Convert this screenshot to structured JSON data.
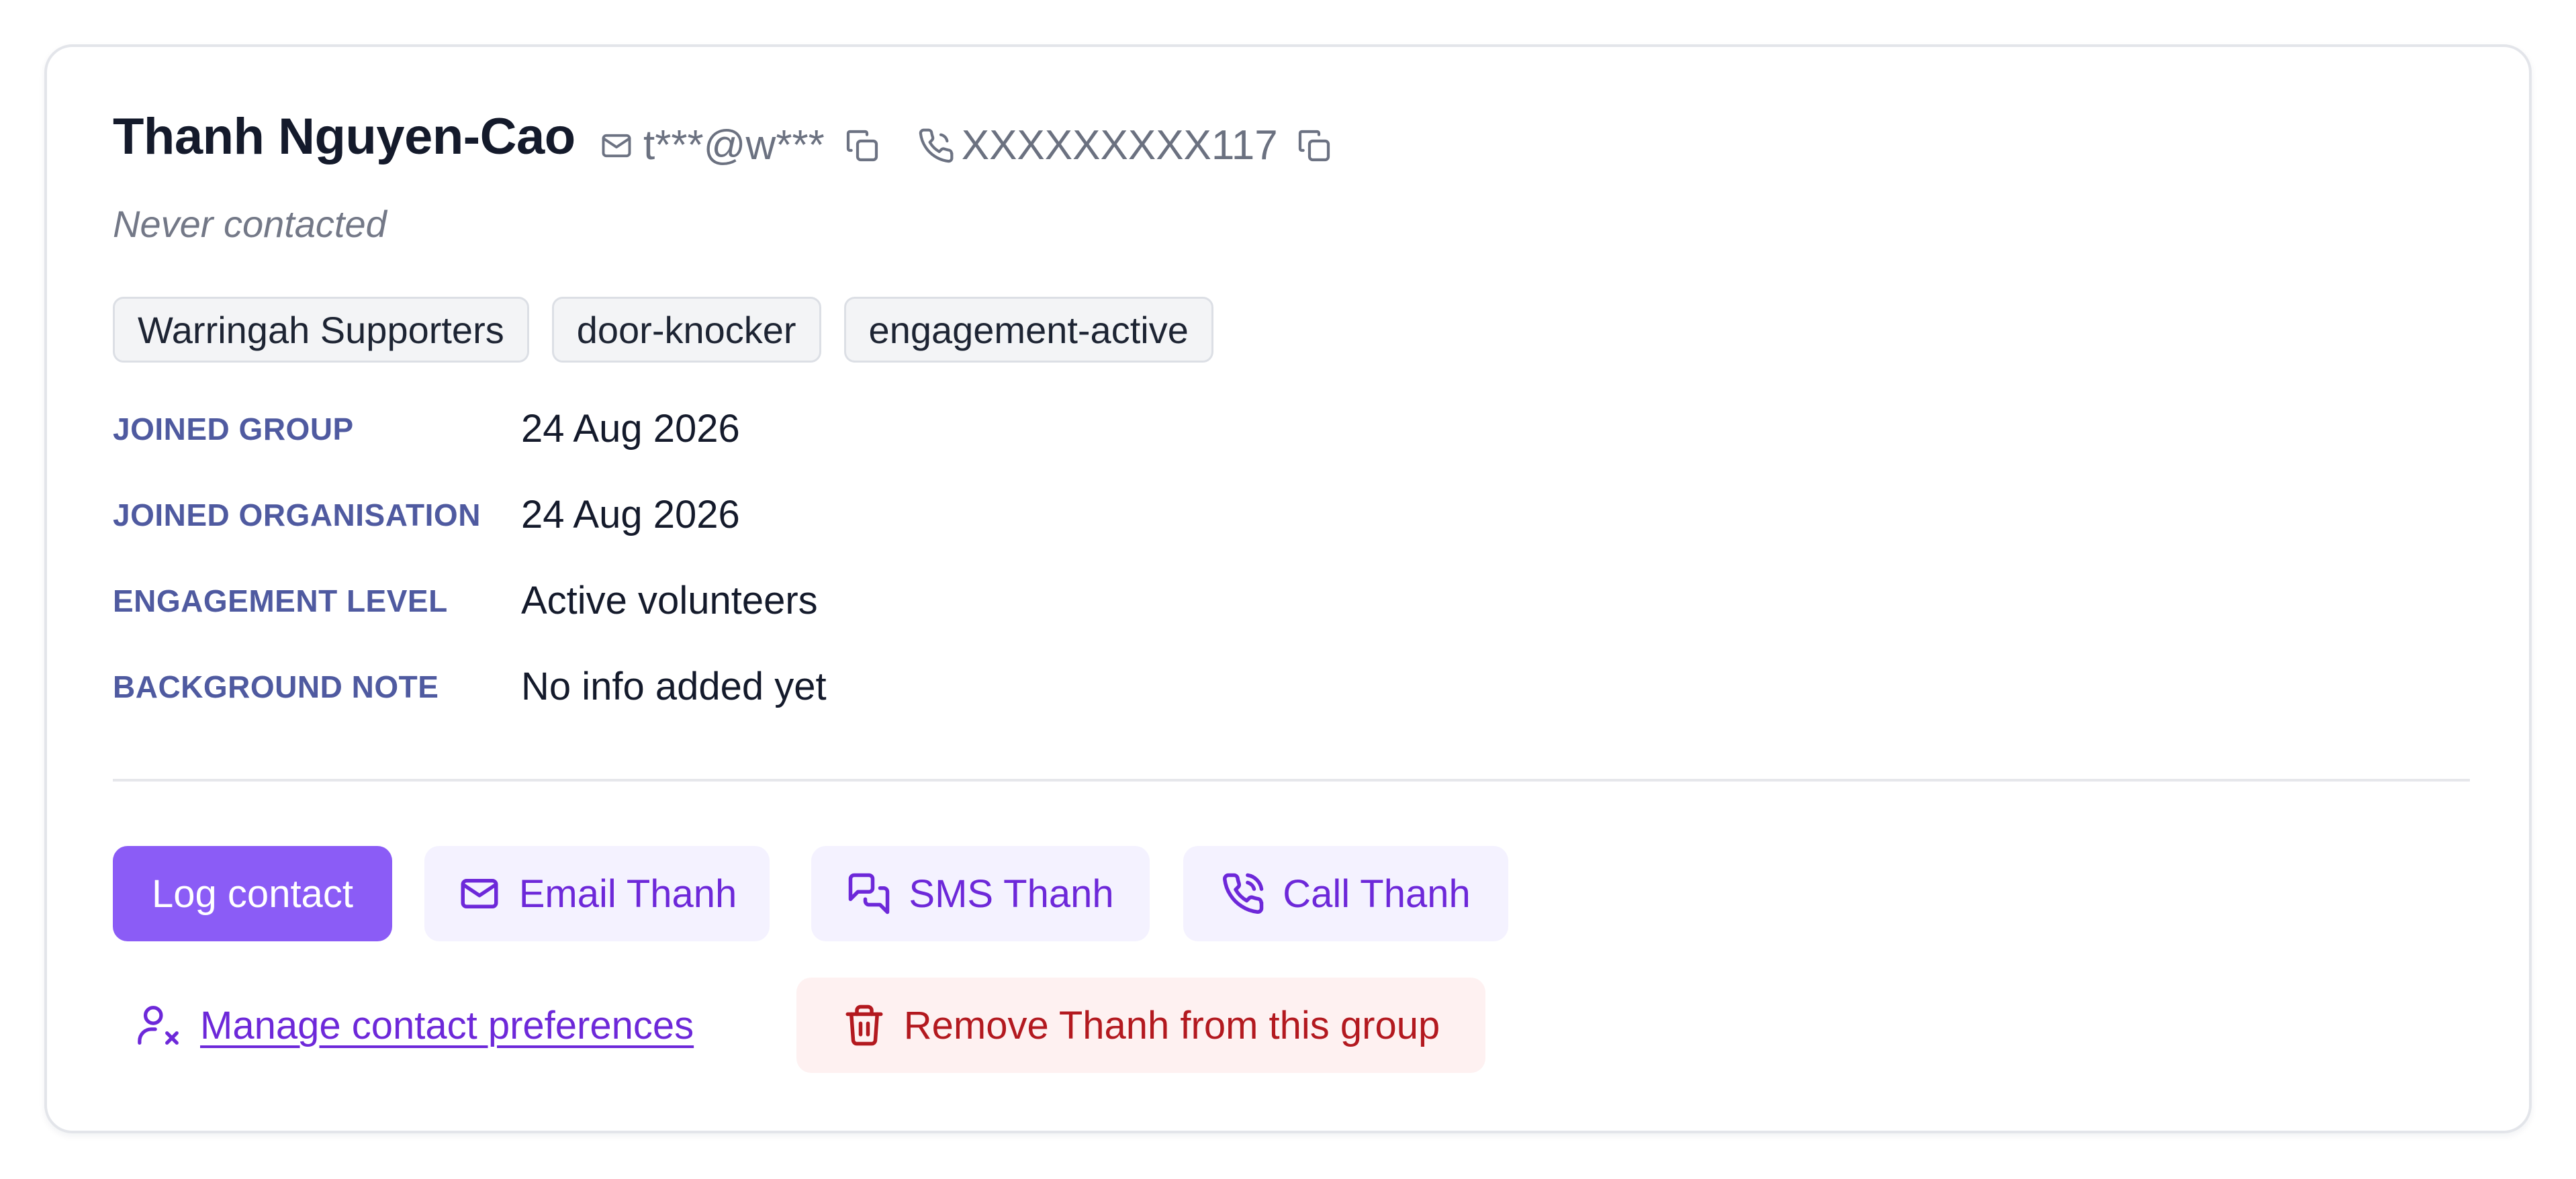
{
  "contact": {
    "name": "Thanh Nguyen-Cao",
    "email_masked": "t***@w***",
    "phone_masked": "XXXXXXXXX117",
    "status": "Never contacted"
  },
  "tags": [
    "Warringah Supporters",
    "door-knocker",
    "engagement-active"
  ],
  "details": [
    {
      "label": "JOINED GROUP",
      "value": "24 Aug 2026"
    },
    {
      "label": "JOINED ORGANISATION",
      "value": "24 Aug 2026"
    },
    {
      "label": "ENGAGEMENT LEVEL",
      "value": "Active volunteers"
    },
    {
      "label": "BACKGROUND NOTE",
      "value": "No info added yet"
    }
  ],
  "actions": {
    "log_contact": "Log contact",
    "email": "Email Thanh",
    "sms": "SMS Thanh",
    "call": "Call Thanh",
    "manage_preferences": "Manage contact preferences",
    "remove": "Remove Thanh from this group"
  },
  "icons": {
    "email": "mail-icon",
    "phone": "phone-icon",
    "copy": "copy-icon",
    "sms": "message-bubbles-icon",
    "call": "phone-call-icon",
    "preferences": "user-x-icon",
    "remove": "trash-icon"
  },
  "colors": {
    "primary": "#8b5cf6",
    "accent_text": "#6d28d9",
    "soft_button_bg": "#f4f2ff",
    "danger_text": "#b3191f",
    "danger_bg": "#fef1f1",
    "label": "#4f5aa0"
  }
}
